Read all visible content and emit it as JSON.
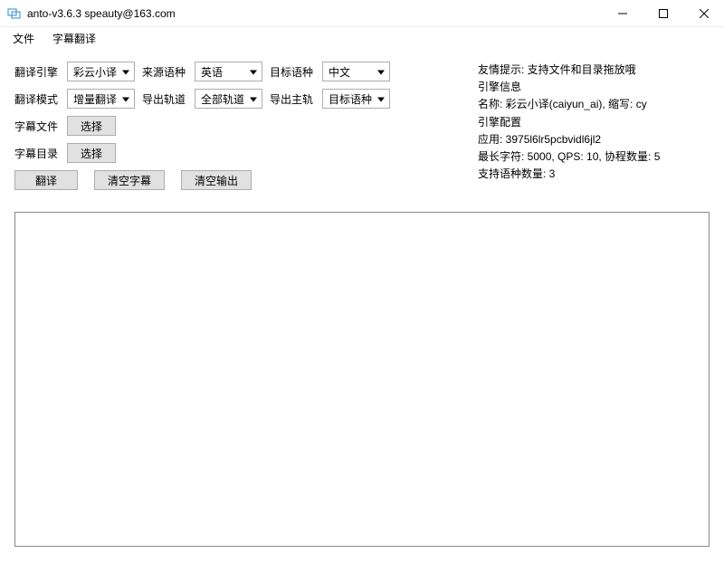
{
  "window": {
    "title": "anto-v3.6.3 speauty@163.com"
  },
  "menu": {
    "file": "文件",
    "subtitle_translate": "字幕翻译"
  },
  "labels": {
    "engine": "翻译引擎",
    "mode": "翻译模式",
    "source_lang": "来源语种",
    "target_lang": "目标语种",
    "export_track": "导出轨道",
    "export_main": "导出主轨",
    "subtitle_file": "字幕文件",
    "subtitle_dir": "字幕目录"
  },
  "selects": {
    "engine": "彩云小译",
    "mode": "增量翻译",
    "source_lang": "英语",
    "target_lang": "中文",
    "export_track": "全部轨道",
    "export_main": "目标语种"
  },
  "buttons": {
    "choose": "选择",
    "translate": "翻译",
    "clear_subtitle": "清空字幕",
    "clear_output": "清空输出"
  },
  "info": {
    "tip": "友情提示: 支持文件和目录拖放哦",
    "engine_info": "引擎信息",
    "name": "名称: 彩云小译(caiyun_ai), 缩写: cy",
    "config": "引擎配置",
    "app": "应用: 3975l6lr5pcbvidl6jl2",
    "limits": "最长字符: 5000, QPS: 10, 协程数量: 5",
    "lang_count": "支持语种数量: 3"
  }
}
